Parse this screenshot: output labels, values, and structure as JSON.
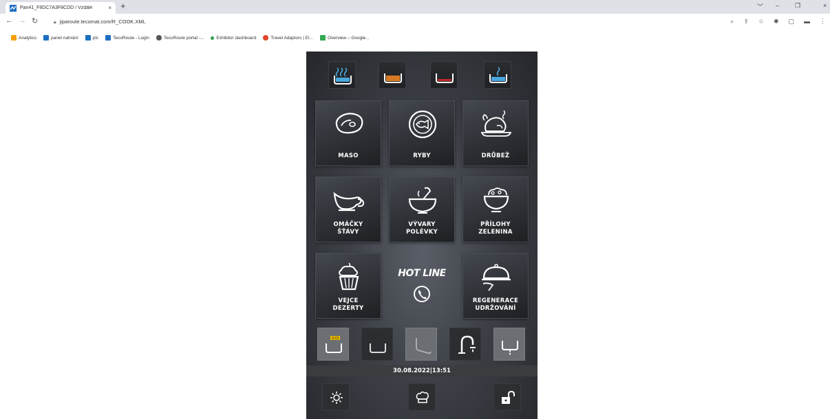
{
  "browser": {
    "tab_title": "Pan41_F8DC7A3F8CDD / Vzdále",
    "tab_close": "×",
    "new_tab": "+",
    "window_controls": {
      "minimize": "–",
      "restore": "❐",
      "close": "×",
      "dropdown": "﹀"
    },
    "url": "jiparoute.tecomat.com/R_COOK.XML",
    "bookmarks": [
      {
        "label": "Analytics",
        "icon": "analytics-icon",
        "color": "#f4a100"
      },
      {
        "label": "panel nahrání",
        "icon": "tecoroute-icon",
        "color": "#1e6fc2"
      },
      {
        "label": "plc",
        "icon": "tecoroute-icon",
        "color": "#1e6fc2"
      },
      {
        "label": "TecoRoute - Login",
        "icon": "tecoroute-icon",
        "color": "#1e6fc2"
      },
      {
        "label": "TecoRoute portal -...",
        "icon": "globe-icon",
        "color": "#555555"
      },
      {
        "label": "Exhibitor dashboard",
        "icon": "dot-icon",
        "color": "#2e9d4a"
      },
      {
        "label": "Travel Adaptors | El...",
        "icon": "travel-icon",
        "color": "#e2452a"
      },
      {
        "label": "Overview – Google...",
        "icon": "location-icon",
        "color": "#34a853"
      }
    ]
  },
  "app": {
    "bath_icons": [
      {
        "name": "steam-bath-icon",
        "fill": "#4aa8e0"
      },
      {
        "name": "hot-oil-bath-icon",
        "fill": "#e0822a"
      },
      {
        "name": "red-bath-icon",
        "fill": "#c42a2a"
      },
      {
        "name": "water-bath-icon",
        "fill": "#4aa8e0"
      }
    ],
    "tiles": [
      {
        "key": "maso",
        "lines": [
          "MASO"
        ],
        "icon": "steak-icon"
      },
      {
        "key": "ryby",
        "lines": [
          "RYBY"
        ],
        "icon": "fish-plate-icon"
      },
      {
        "key": "drubez",
        "lines": [
          "DRŮBEŽ"
        ],
        "icon": "poultry-icon"
      },
      {
        "key": "omacky",
        "lines": [
          "OMÁČKY",
          "ŠŤÁVY"
        ],
        "icon": "gravy-boat-icon"
      },
      {
        "key": "vyvary",
        "lines": [
          "VÝVARY",
          "POLÉVKY"
        ],
        "icon": "soup-bowl-icon"
      },
      {
        "key": "prilohy",
        "lines": [
          "PŘÍLOHY",
          "ZELENINA"
        ],
        "icon": "side-dish-icon"
      },
      {
        "key": "vejce",
        "lines": [
          "VEJCE",
          "DEZERTY"
        ],
        "icon": "cupcake-icon"
      },
      {
        "key": "regenerace",
        "lines": [
          "REGENERACE",
          "UDRŽOVÁNÍ"
        ],
        "icon": "cloche-icon"
      }
    ],
    "hotline": {
      "title": "HOT LINE",
      "icon": "phone-icon"
    },
    "controls": [
      {
        "name": "basket-control",
        "icon": "basket-icon",
        "style": "light"
      },
      {
        "name": "pan-control",
        "icon": "pan-icon",
        "style": "dark"
      },
      {
        "name": "tilt-control",
        "icon": "tilt-icon",
        "style": "light"
      },
      {
        "name": "faucet-control",
        "icon": "faucet-icon",
        "style": "dark"
      },
      {
        "name": "drain-control",
        "icon": "drain-icon",
        "style": "light"
      }
    ],
    "datetime": "30.08.2022|13:51",
    "bottom": [
      {
        "name": "settings-button",
        "icon": "gear-icon"
      },
      {
        "name": "chef-button",
        "icon": "chef-hat-icon"
      },
      {
        "name": "unlock-button",
        "icon": "unlock-icon"
      }
    ]
  }
}
